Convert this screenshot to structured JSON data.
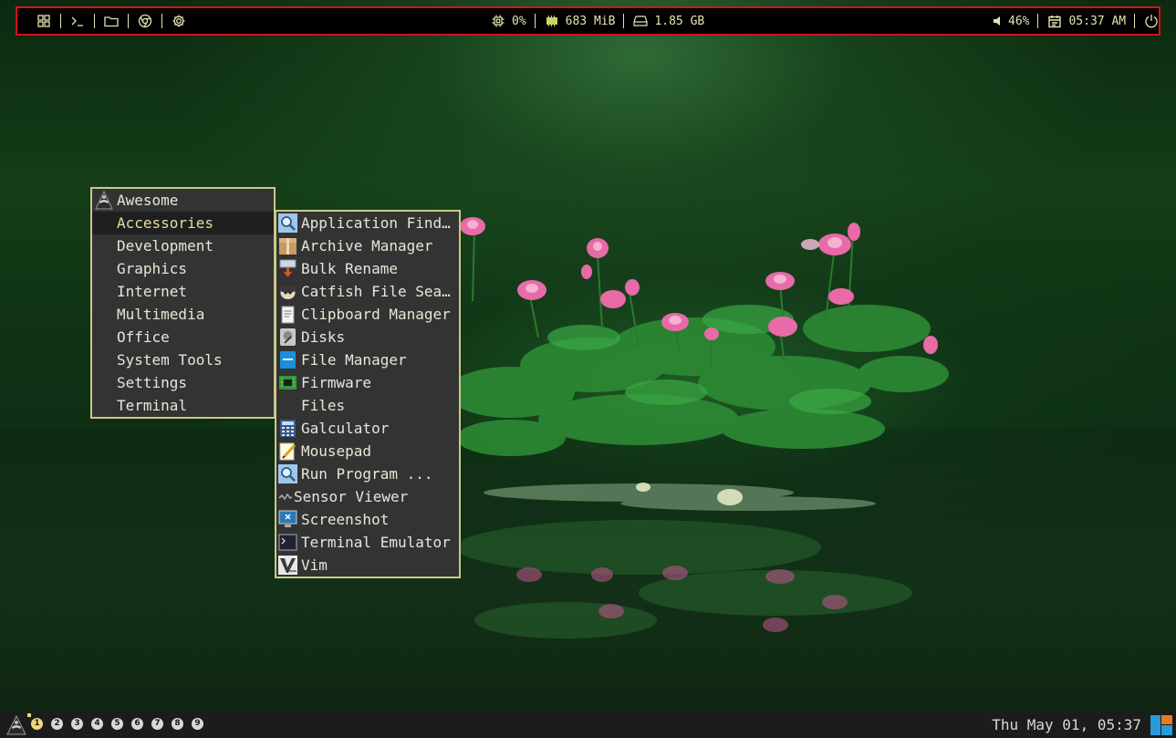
{
  "topbar": {
    "launchers": [
      {
        "name": "apps-grid-icon"
      },
      {
        "name": "terminal-icon"
      },
      {
        "name": "folder-icon"
      },
      {
        "name": "browser-icon"
      },
      {
        "name": "settings-icon"
      }
    ],
    "cpu": "0%",
    "memory": "683 MiB",
    "disk": "1.85 GB",
    "volume": "46%",
    "time": "05:37 AM",
    "accent_color": "#e6e2b0",
    "border_color": "#d4131b"
  },
  "main_menu": {
    "items": [
      {
        "label": "Awesome",
        "icon": "awesome-logo-icon"
      },
      {
        "label": "Accessories",
        "active": true
      },
      {
        "label": "Development"
      },
      {
        "label": "Graphics"
      },
      {
        "label": "Internet"
      },
      {
        "label": "Multimedia"
      },
      {
        "label": "Office"
      },
      {
        "label": "System Tools"
      },
      {
        "label": "Settings"
      },
      {
        "label": "Terminal"
      }
    ]
  },
  "submenu": {
    "items": [
      {
        "label": "Application Find…",
        "icon": "magnifier-icon"
      },
      {
        "label": "Archive Manager",
        "icon": "archive-box-icon"
      },
      {
        "label": "Bulk Rename",
        "icon": "bulk-rename-icon"
      },
      {
        "label": "Catfish File Sea…",
        "icon": "catfish-icon"
      },
      {
        "label": "Clipboard Manager",
        "icon": "clipboard-icon"
      },
      {
        "label": "Disks",
        "icon": "disks-icon"
      },
      {
        "label": "File Manager",
        "icon": "file-manager-icon"
      },
      {
        "label": "Firmware",
        "icon": "firmware-chip-icon"
      },
      {
        "label": "Files",
        "icon": ""
      },
      {
        "label": "Galculator",
        "icon": "calculator-icon"
      },
      {
        "label": "Mousepad",
        "icon": "notepad-icon"
      },
      {
        "label": "Run Program ...",
        "icon": "magnifier-icon"
      },
      {
        "label": "Sensor Viewer",
        "icon": "sensor-icon"
      },
      {
        "label": "Screenshot",
        "icon": "screenshot-icon"
      },
      {
        "label": "Terminal Emulator",
        "icon": "terminal-emulator-icon"
      },
      {
        "label": "Vim",
        "icon": "vim-icon"
      }
    ]
  },
  "bottombar": {
    "tags": [
      "1",
      "2",
      "3",
      "4",
      "5",
      "6",
      "7",
      "8",
      "9"
    ],
    "active_tag": "1",
    "clock": "Thu May 01, 05:37"
  }
}
